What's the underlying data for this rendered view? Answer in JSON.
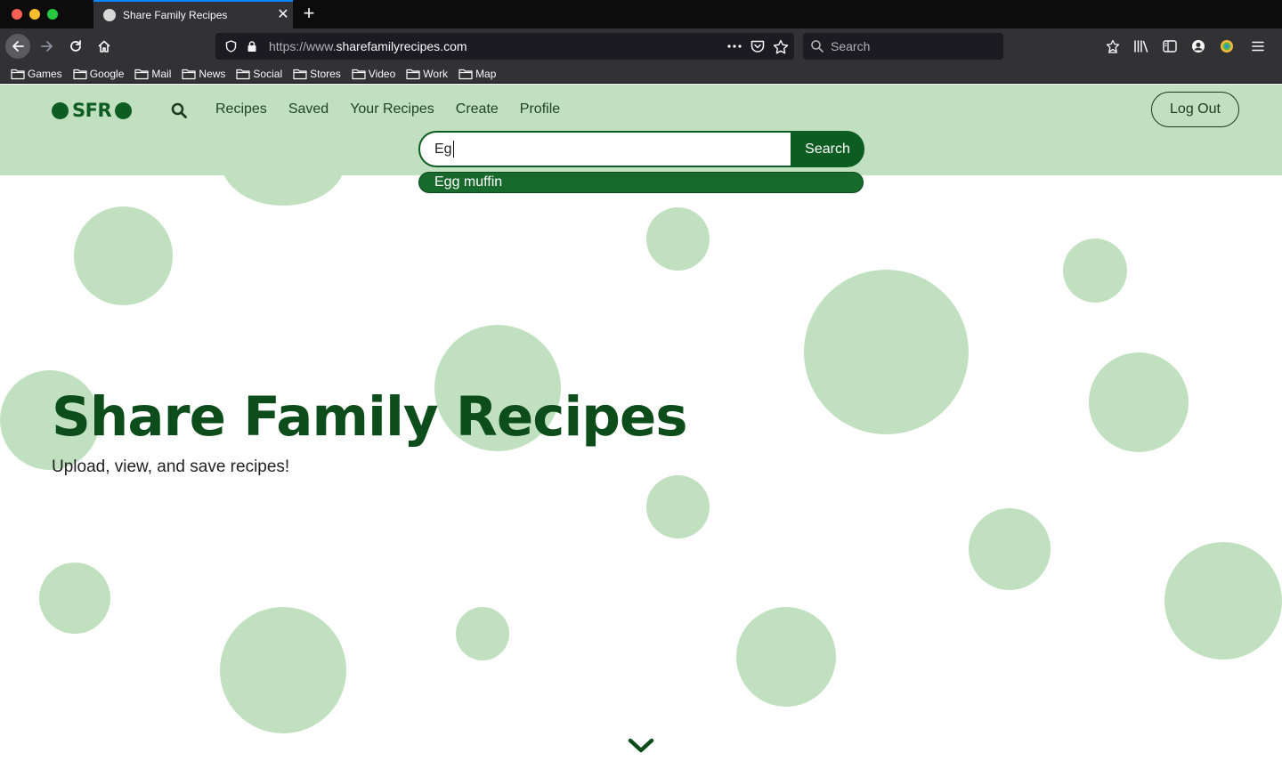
{
  "browser": {
    "tab": {
      "title": "Share Family Recipes",
      "close_glyph": "✕"
    },
    "new_tab_glyph": "+",
    "url": {
      "prefix": "https://www.",
      "domain": "sharefamilyrecipes.com"
    },
    "search_placeholder": "Search",
    "bookmarks": [
      "Games",
      "Google",
      "Mail",
      "News",
      "Social",
      "Stores",
      "Video",
      "Work",
      "Map"
    ]
  },
  "site": {
    "logo_text": "SFR",
    "nav": [
      "Recipes",
      "Saved",
      "Your Recipes",
      "Create",
      "Profile"
    ],
    "logout_label": "Log Out",
    "search": {
      "value": "Eg",
      "button_label": "Search"
    },
    "suggestions": [
      "Egg muffin"
    ],
    "hero": {
      "title": "Share Family Recipes",
      "subtitle": "Upload, view, and save recipes!"
    }
  },
  "colors": {
    "brand_green": "#0d5c22",
    "header_bg": "#c0e0c0",
    "bubble": "#c0e0c0",
    "hero_title": "#0d4d1c",
    "chrome_dark": "#323234",
    "tab_accent": "#0a84ff"
  }
}
